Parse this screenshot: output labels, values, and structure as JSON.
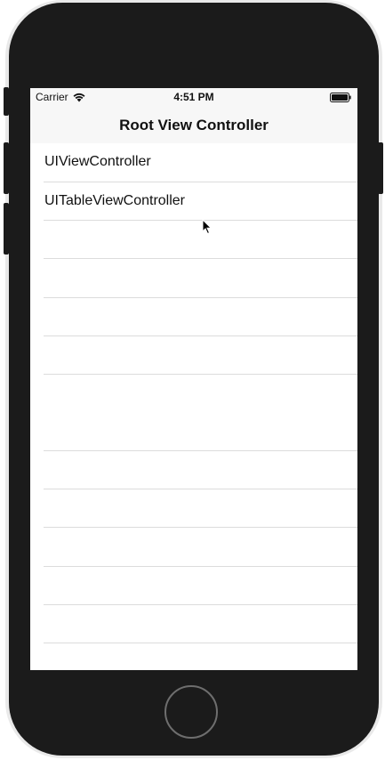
{
  "status_bar": {
    "carrier": "Carrier",
    "time": "4:51 PM",
    "wifi_icon": "wifi-icon",
    "battery_icon": "battery-icon"
  },
  "nav_bar": {
    "title": "Root View Controller"
  },
  "table": {
    "rows": [
      {
        "label": "UIViewController"
      },
      {
        "label": "UITableViewController"
      }
    ]
  },
  "device": {
    "frame_color": "#1b1b1b",
    "screen_bg": "#ffffff",
    "home_button_icon": "home-button"
  },
  "cursor_icon": "mouse-pointer-icon"
}
